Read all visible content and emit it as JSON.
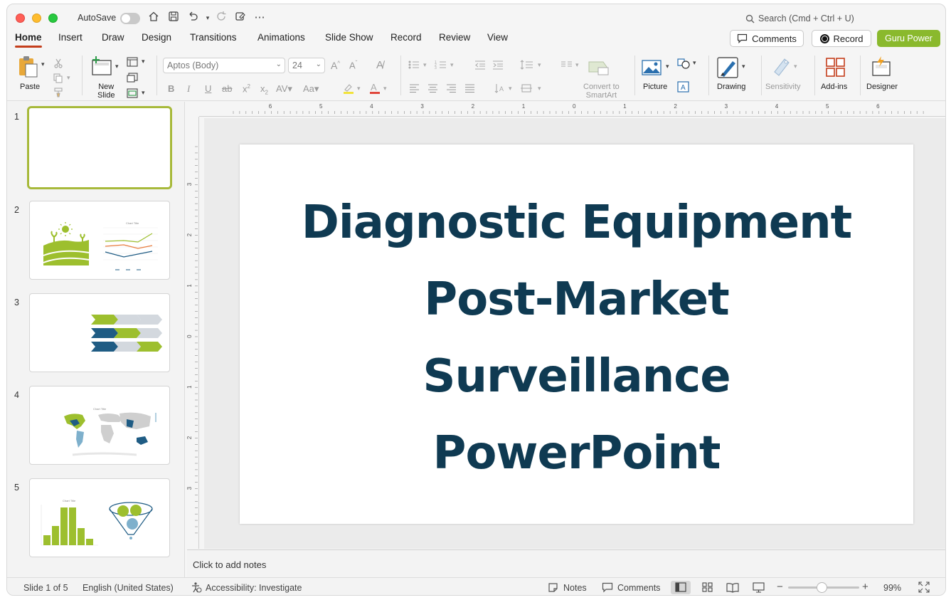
{
  "titlebar": {
    "autosave_label": "AutoSave",
    "search_placeholder": "Search (Cmd + Ctrl + U)"
  },
  "tabs": [
    {
      "label": "Home",
      "active": true
    },
    {
      "label": "Insert"
    },
    {
      "label": "Draw"
    },
    {
      "label": "Design"
    },
    {
      "label": "Transitions"
    },
    {
      "label": "Animations"
    },
    {
      "label": "Slide Show"
    },
    {
      "label": "Record"
    },
    {
      "label": "Review"
    },
    {
      "label": "View"
    }
  ],
  "header_buttons": {
    "comments": "Comments",
    "record": "Record",
    "guru": "Guru Power"
  },
  "ribbon": {
    "paste": "Paste",
    "new_slide_1": "New",
    "new_slide_2": "Slide",
    "font_name": "Aptos (Body)",
    "font_size": "24",
    "convert_1": "Convert to",
    "convert_2": "SmartArt",
    "picture": "Picture",
    "drawing": "Drawing",
    "sensitivity": "Sensitivity",
    "addins": "Add-ins",
    "designer": "Designer"
  },
  "thumbnails": [
    {
      "number": "1"
    },
    {
      "number": "2"
    },
    {
      "number": "3"
    },
    {
      "number": "4"
    },
    {
      "number": "5"
    }
  ],
  "slide": {
    "title_lines": [
      "Diagnostic Equipment",
      "Post-Market",
      "Surveillance",
      "PowerPoint"
    ]
  },
  "ruler": {
    "top_labels": [
      "6",
      "5",
      "4",
      "3",
      "2",
      "1",
      "0",
      "1",
      "2",
      "3",
      "4",
      "5",
      "6"
    ],
    "left_labels": [
      "3",
      "2",
      "1",
      "0",
      "1",
      "2",
      "3"
    ]
  },
  "notes_placeholder": "Click to add notes",
  "status": {
    "slide_info": "Slide 1 of 5",
    "language": "English (United States)",
    "accessibility": "Accessibility: Investigate",
    "notes": "Notes",
    "comments": "Comments",
    "zoom": "99%"
  },
  "colors": {
    "accent_tab": "#c43e1c",
    "guru_green": "#8ab92d",
    "title_navy": "#0f3a52",
    "thumb_green": "#9dbf2e",
    "thumb_blue": "#1f5c84"
  }
}
